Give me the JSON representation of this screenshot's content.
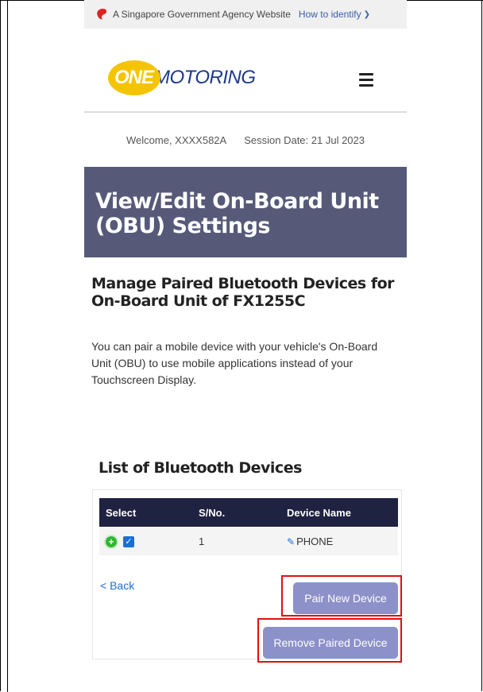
{
  "gov_bar": {
    "agency_text": "A Singapore Government Agency Website",
    "identify_link": "How to identify"
  },
  "header": {
    "logo_one": "ONE",
    "logo_motoring": "MOTORING"
  },
  "welcome": {
    "welcome_text": "Welcome, XXXX582A",
    "session_text": "Session Date: 21 Jul 2023"
  },
  "page_title": "View/Edit On-Board Unit (OBU) Settings",
  "section": {
    "title": "Manage Paired Bluetooth Devices for On-Board Unit of FX1255C",
    "description": "You can pair a mobile device with your vehicle's On-Board Unit (OBU) to use mobile applications instead of your Touchscreen Display."
  },
  "device_list": {
    "title": "List of Bluetooth Devices",
    "columns": [
      "Select",
      "S/No.",
      "Device Name"
    ],
    "rows": [
      {
        "sno": "1",
        "device_name": "PHONE",
        "selected": true
      }
    ]
  },
  "actions": {
    "back_label": "< Back",
    "pair_label": "Pair New Device",
    "remove_label": "Remove Paired Device"
  },
  "colors": {
    "banner": "#565a78",
    "table_header": "#1f2240",
    "button": "#8d91c9",
    "highlight": "#e01010",
    "logo_yellow": "#f5c400",
    "logo_blue": "#1e3a8a"
  }
}
